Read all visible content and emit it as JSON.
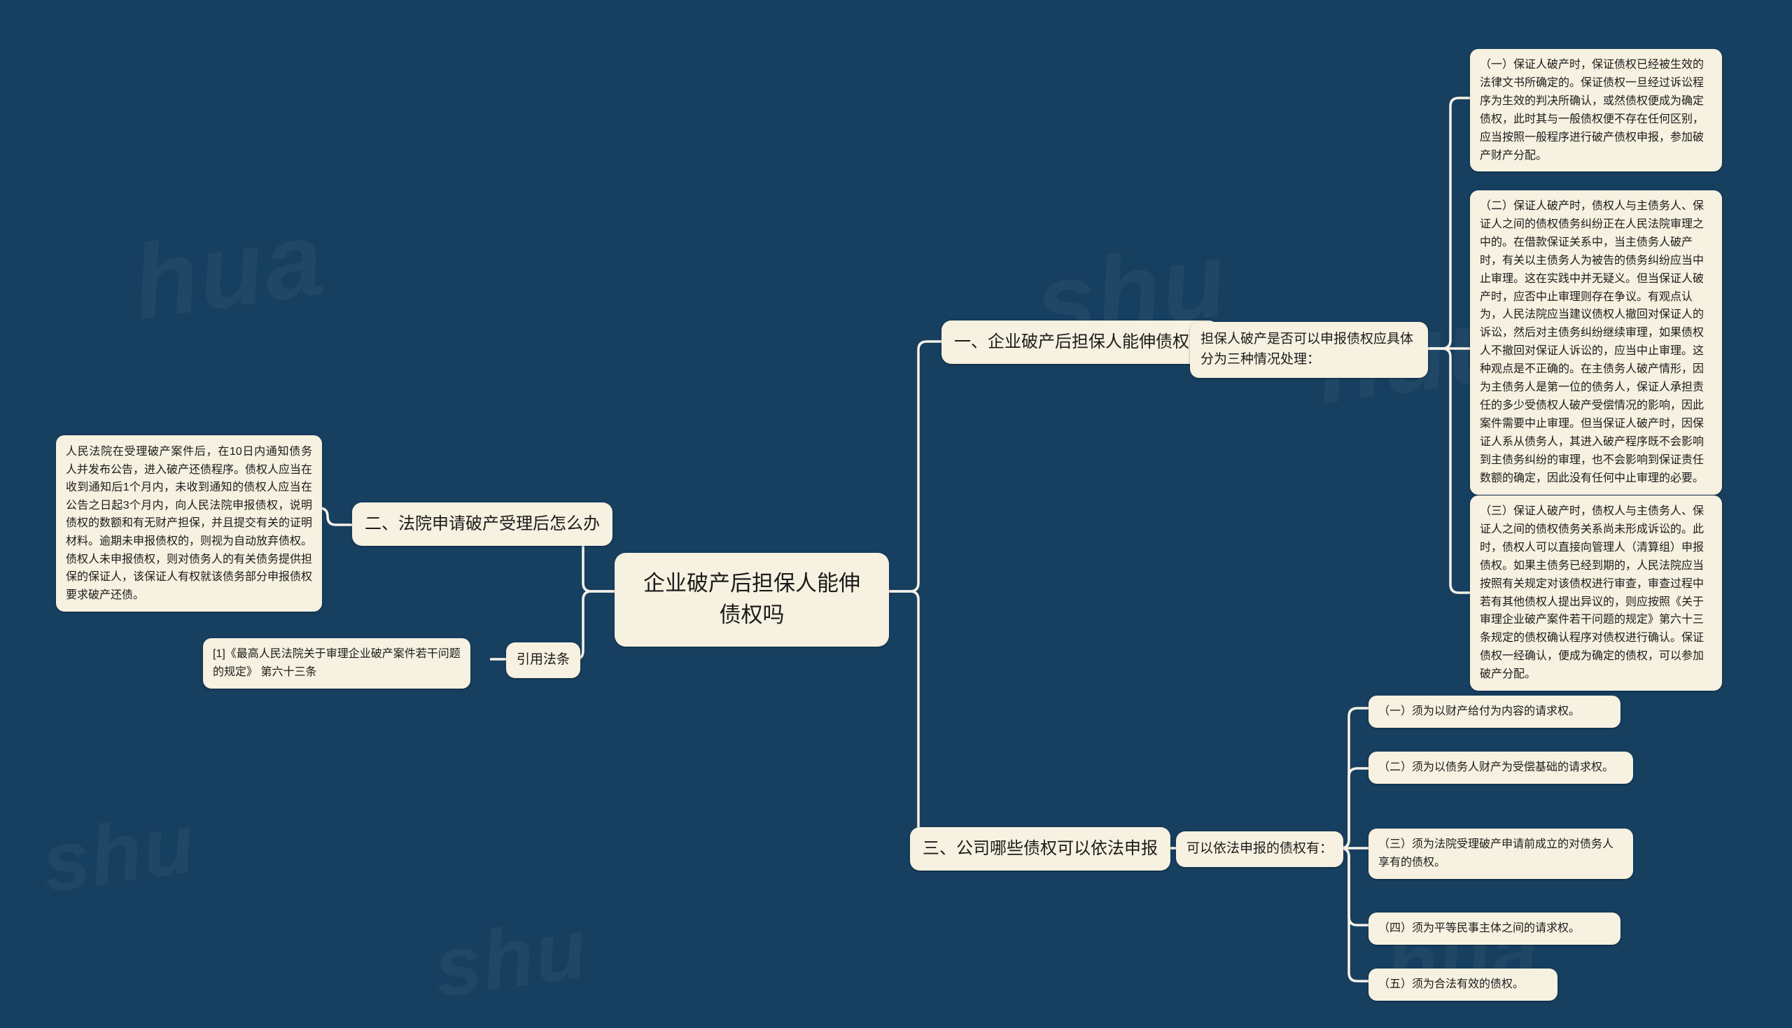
{
  "theme": {
    "background_color": "#173f60",
    "node_fill_color": "#f6f1e0",
    "node_text_color": "#1b1b1b",
    "connector_color": "#f7f3e8"
  },
  "watermarks": {
    "a": "hua",
    "b": "shu",
    "c": "huu",
    "d": "shu",
    "e": "hua",
    "f": "shu"
  },
  "root": {
    "label": "企业破产后担保人能伸债权吗"
  },
  "branches": {
    "left": [
      {
        "label": "二、法院申请破产受理后怎么办",
        "body": "人民法院在受理破产案件后，在10日内通知债务人并发布公告，进入破产还债程序。债权人应当在收到通知后1个月内，未收到通知的债权人应当在公告之日起3个月内，向人民法院申报债权，说明债权的数额和有无财产担保，并且提交有关的证明材料。逾期未申报债权的，则视为自动放弃债权。债权人未申报债权，则对债务人的有关债务提供担保的保证人，该保证人有权就该债务部分申报债权要求破产还债。"
      },
      {
        "label": "引用法条",
        "body": "[1]《最高人民法院关于审理企业破产案件若干问题的规定》 第六十三条"
      }
    ],
    "right": [
      {
        "label": "一、企业破产后担保人能伸债权吗",
        "intro": "担保人破产是否可以申报债权应具体分为三种情况处理：",
        "items": [
          "（一）保证人破产时，保证债权已经被生效的法律文书所确定的。保证债权一旦经过诉讼程序为生效的判决所确认，或然债权便成为确定债权，此时其与一般债权便不存在任何区别，应当按照一般程序进行破产债权申报，参加破产财产分配。",
          "（二）保证人破产时，债权人与主债务人、保证人之间的债权债务纠纷正在人民法院审理之中的。在借款保证关系中，当主债务人破产时，有关以主债务人为被告的债务纠纷应当中止审理。这在实践中并无疑义。但当保证人破产时，应否中止审理则存在争议。有观点认为，人民法院应当建议债权人撤回对保证人的诉讼，然后对主债务纠纷继续审理，如果债权人不撤回对保证人诉讼的，应当中止审理。这种观点是不正确的。在主债务人破产情形，因为主债务人是第一位的债务人，保证人承担责任的多少受债权人破产受偿情况的影响，因此案件需要中止审理。但当保证人破产时，因保证人系从债务人，其进入破产程序既不会影响到主债务纠纷的审理，也不会影响到保证责任数额的确定，因此没有任何中止审理的必要。",
          "（三）保证人破产时，债权人与主债务人、保证人之间的债权债务关系尚未形成诉讼的。此时，债权人可以直接向管理人（清算组）申报债权。如果主债务已经到期的，人民法院应当按照有关规定对该债权进行审查，审查过程中若有其他债权人提出异议的，则应按照《关于审理企业破产案件若干问题的规定》第六十三条规定的债权确认程序对债权进行确认。保证债权一经确认，便成为确定的债权，可以参加破产分配。"
        ]
      },
      {
        "label": "三、公司哪些债权可以依法申报",
        "intro": "可以依法申报的债权有：",
        "items": [
          "（一）须为以财产给付为内容的请求权。",
          "（二）须为以债务人财产为受偿基础的请求权。",
          "（三）须为法院受理破产申请前成立的对债务人享有的债权。",
          "（四）须为平等民事主体之间的请求权。",
          "（五）须为合法有效的债权。"
        ]
      }
    ]
  }
}
